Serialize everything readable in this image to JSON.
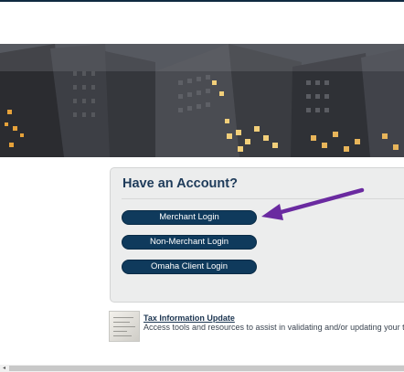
{
  "account_panel": {
    "title": "Have an Account?",
    "buttons": {
      "merchant_login": "Merchant Login",
      "non_merchant_login": "Non-Merchant Login",
      "omaha_client_login": "Omaha Client Login"
    }
  },
  "tax_update": {
    "title": "Tax Information Update",
    "description": "Access tools and resources to assist in validating and/or updating your tax info"
  },
  "colors": {
    "button": "#0f3a5c",
    "title": "#1e3b5a",
    "arrow": "#6a2aa0",
    "panel": "#eceded"
  },
  "icons": {
    "arrow": "purple-arrow-icon",
    "scroll_left": "scroll-left-arrow-icon",
    "tax_thumbnail": "document-thumbnail-icon"
  }
}
